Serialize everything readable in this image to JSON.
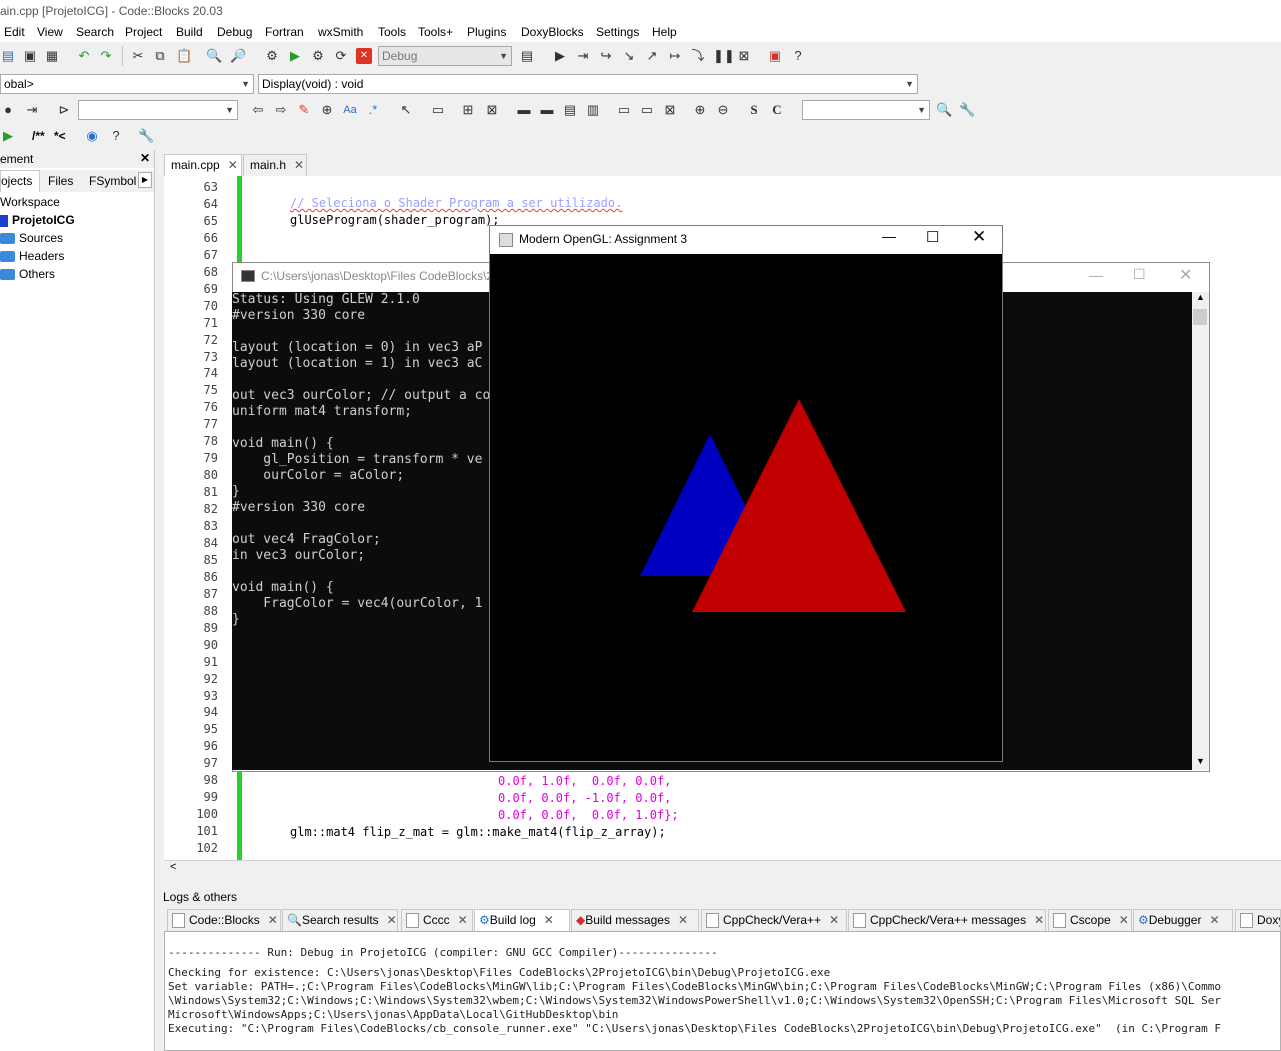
{
  "window": {
    "title": "ain.cpp [ProjetoICG] - Code::Blocks 20.03"
  },
  "menu": [
    "Edit",
    "View",
    "Search",
    "Project",
    "Build",
    "Debug",
    "Fortran",
    "wxSmith",
    "Tools",
    "Tools+",
    "Plugins",
    "DoxyBlocks",
    "Settings",
    "Help"
  ],
  "toolbar": {
    "build_target": "Debug",
    "scope": "obal>",
    "function": "Display(void) : void"
  },
  "toolbar3": {
    "comment_block": "/**",
    "comment_line": "*<"
  },
  "management": {
    "title": "ement",
    "tabs": [
      "ojects",
      "Files",
      "FSymbol"
    ],
    "workspace": "Workspace",
    "project": "ProjetoICG",
    "folders": [
      "Sources",
      "Headers",
      "Others"
    ]
  },
  "editor": {
    "tabs": [
      "main.cpp",
      "main.h"
    ],
    "line_numbers": [
      "63",
      "64",
      "65",
      "66",
      "67",
      "68",
      "69",
      "70",
      "71",
      "72",
      "73",
      "74",
      "75",
      "76",
      "77",
      "78",
      "79",
      "80",
      "81",
      "82",
      "83",
      "84",
      "85",
      "86",
      "87",
      "88",
      "89",
      "90",
      "91",
      "92",
      "93",
      "94",
      "95",
      "96",
      "97",
      "98",
      "99",
      "100",
      "101",
      "102"
    ],
    "visible_code": {
      "l64": "// Seleciona o Shader Program a ser utilizado.",
      "l65": "glUseProgram(shader_program);",
      "l98": "0.0f, 1.0f,  0.0f, 0.0f,",
      "l99": "0.0f, 0.0f, -1.0f, 0.0f,",
      "l100": "0.0f, 0.0f,  0.0f, 1.0f};",
      "l101": "glm::mat4 flip_z_mat = glm::make_mat4(flip_z_array);"
    }
  },
  "console": {
    "title": "C:\\Users\\jonas\\Desktop\\Files CodeBlocks\\2",
    "lines": [
      "Status: Using GLEW 2.1.0",
      "#version 330 core",
      "",
      "layout (location = 0) in vec3 aP",
      "layout (location = 1) in vec3 aC",
      "",
      "out vec3 ourColor; // output a co",
      "uniform mat4 transform;",
      "",
      "void main() {",
      "    gl_Position = transform * ve",
      "    ourColor = aColor;",
      "}",
      "#version 330 core",
      "",
      "out vec4 FragColor;",
      "in vec3 ourColor;",
      "",
      "void main() {",
      "    FragColor = vec4(ourColor, 1",
      "}"
    ]
  },
  "gl_window": {
    "title": "Modern OpenGL: Assignment 3",
    "colors": {
      "blue": "#0000c0",
      "red": "#c00000"
    }
  },
  "logs": {
    "title": "Logs & others",
    "tabs": [
      "Code::Blocks",
      "Search results",
      "Cccc",
      "Build log",
      "Build messages",
      "CppCheck/Vera++",
      "CppCheck/Vera++ messages",
      "Cscope",
      "Debugger",
      "Doxy"
    ],
    "lines": [
      "-------------- Run: Debug in ProjetoICG (compiler: GNU GCC Compiler)---------------",
      "Checking for existence: C:\\Users\\jonas\\Desktop\\Files CodeBlocks\\2ProjetoICG\\bin\\Debug\\ProjetoICG.exe",
      "Set variable: PATH=.;C:\\Program Files\\CodeBlocks\\MinGW\\lib;C:\\Program Files\\CodeBlocks\\MinGW\\bin;C:\\Program Files\\CodeBlocks\\MinGW;C:\\Program Files (x86)\\Commo",
      "\\Windows\\System32;C:\\Windows;C:\\Windows\\System32\\wbem;C:\\Windows\\System32\\WindowsPowerShell\\v1.0;C:\\Windows\\System32\\OpenSSH;C:\\Program Files\\Microsoft SQL Ser",
      "Microsoft\\WindowsApps;C:\\Users\\jonas\\AppData\\Local\\GitHubDesktop\\bin",
      "Executing: \"C:\\Program Files\\CodeBlocks/cb_console_runner.exe\" \"C:\\Users\\jonas\\Desktop\\Files CodeBlocks\\2ProjetoICG\\bin\\Debug\\ProjetoICG.exe\"  (in C:\\Program F"
    ]
  }
}
